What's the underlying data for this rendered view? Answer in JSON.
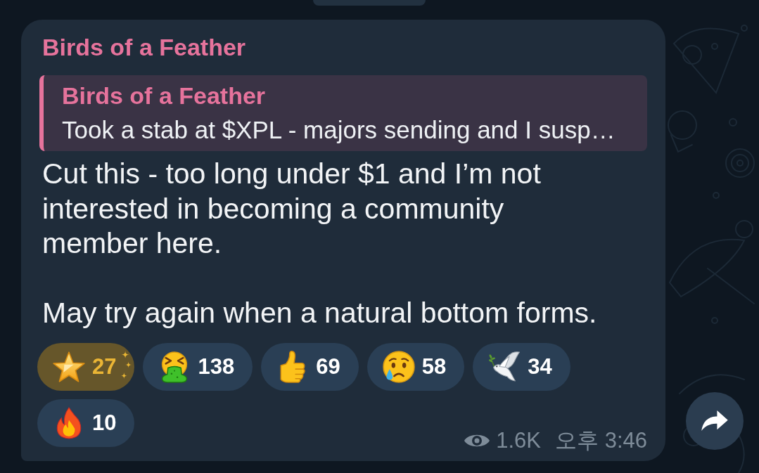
{
  "message": {
    "sender": "Birds of a Feather",
    "reply": {
      "sender": "Birds of a Feather",
      "text": "Took a stab at $XPL - majors sending and I susp…"
    },
    "paragraphs": [
      [
        "Cut this - too long under $1 and I’m not",
        "interested in becoming a community",
        "member here."
      ],
      [
        "May try again when a natural bottom forms."
      ]
    ],
    "reactions": [
      {
        "kind": "star",
        "count": "27",
        "selected": true
      },
      {
        "kind": "vomiting-face",
        "count": "138",
        "selected": false
      },
      {
        "kind": "thumbs-up",
        "count": "69",
        "selected": false
      },
      {
        "kind": "crying-face",
        "count": "58",
        "selected": false
      },
      {
        "kind": "dove",
        "count": "34",
        "selected": false
      },
      {
        "kind": "fire",
        "count": "10",
        "selected": false
      }
    ],
    "views": "1.6K",
    "time": "오후 3:46"
  }
}
